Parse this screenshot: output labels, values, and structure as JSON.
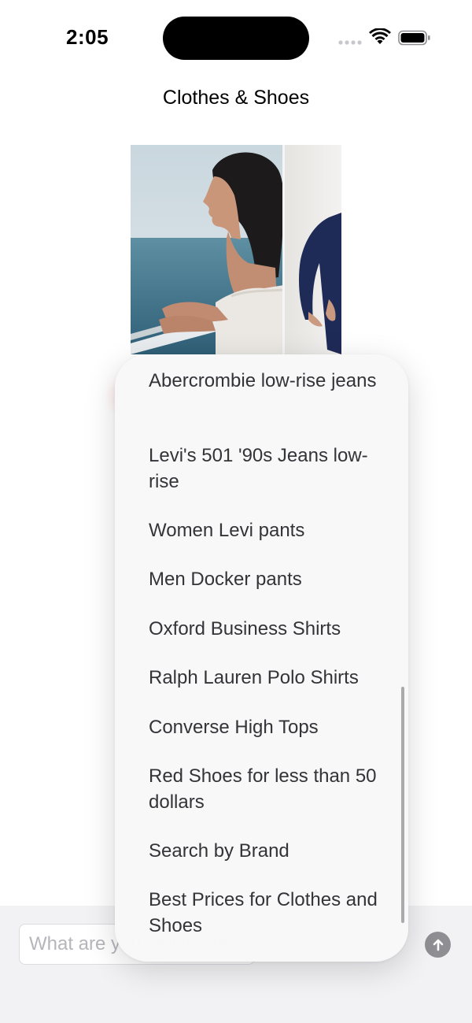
{
  "status_bar": {
    "time": "2:05"
  },
  "nav": {
    "title": "Clothes & Shoes"
  },
  "search": {
    "placeholder": "What are you looking for?"
  },
  "menu": {
    "items": [
      "Abercrombie low-rise jeans",
      "Levi's 501 '90s Jeans low-rise",
      "Women Levi pants",
      "Men Docker pants",
      "Oxford Business Shirts",
      "Ralph Lauren Polo Shirts",
      "Converse High Tops",
      "Red Shoes for less than 50 dollars",
      "Search by Brand",
      "Best Prices for Clothes and Shoes"
    ]
  },
  "icons": {
    "signal": "cellular-signal-icon",
    "wifi": "wifi-icon",
    "battery": "battery-icon",
    "send": "arrow-up-icon"
  },
  "colors": {
    "send_button": "#8e8e93",
    "menu_text": "#333338",
    "bottom_bar": "#f2f2f4"
  }
}
